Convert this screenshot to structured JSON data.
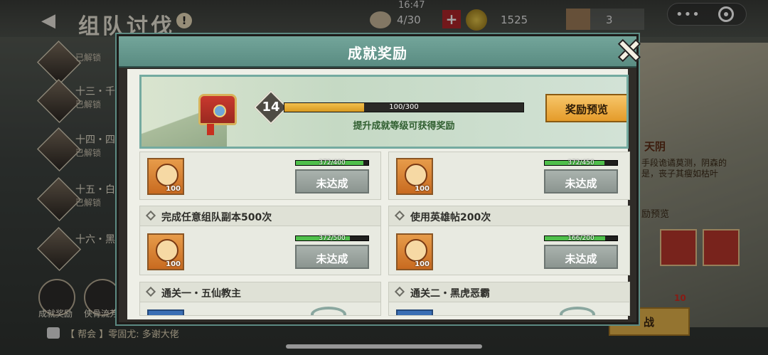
{
  "status_bar": {
    "time": "16:47"
  },
  "background": {
    "title": "组队讨伐",
    "warning_icon": "!",
    "stamina": "4/30",
    "plus_label": "+",
    "coins": "1525",
    "tickets": "3",
    "mini_menu": "•••",
    "side_items": [
      {
        "name": "",
        "status": "已解锁"
      },
      {
        "name": "十三・千面",
        "status": "已解锁"
      },
      {
        "name": "十四・四阿",
        "status": "已解锁"
      },
      {
        "name": "十五・白目",
        "status": "已解锁"
      },
      {
        "name": "十六・黑",
        "status": ""
      }
    ],
    "bottom_buttons": [
      {
        "label": "成就奖励"
      },
      {
        "label": "侠骨流芳"
      }
    ],
    "chat": "【 帮会 】零固尤: 多谢大佬",
    "right_panel": {
      "title": "天阴",
      "desc": "手段诡谲莫测，阴森的是，丧子其瘦如枯叶",
      "preview": "励预览",
      "fight_label": "战",
      "fight_cost": "10"
    }
  },
  "modal": {
    "title": "成就奖励",
    "banner": {
      "level": "14",
      "progress_text": "100/300",
      "progress": 0.333,
      "hint": "提升成就等级可获得奖励",
      "preview_button": "奖励预览"
    },
    "achievements": [
      {
        "title": "",
        "progress_text": "372/400",
        "progress": 0.93,
        "reward_qty": "100",
        "status": "未达成"
      },
      {
        "title": "",
        "progress_text": "372/450",
        "progress": 0.827,
        "reward_qty": "100",
        "status": "未达成"
      },
      {
        "title": "完成任意组队副本500次",
        "progress_text": "372/500",
        "progress": 0.744,
        "reward_qty": "100",
        "status": "未达成"
      },
      {
        "title": "使用英雄帖200次",
        "progress_text": "166/200",
        "progress": 0.83,
        "reward_qty": "100",
        "status": "未达成"
      },
      {
        "title": "通关一・五仙教主",
        "progress_text": "",
        "progress": null,
        "reward_qty": "",
        "status": ""
      },
      {
        "title": "通关二・黑虎恶霸",
        "progress_text": "",
        "progress": null,
        "reward_qty": "",
        "status": ""
      }
    ]
  },
  "colors": {
    "header_teal": "#5a8c82",
    "progress_green": "#4fbf4b",
    "xp_gold": "#e0a42a",
    "button_gold": "#f2b34d",
    "disabled_gray": "#9aa39f"
  },
  "icons": {
    "close": "close-icon",
    "chest": "treasure-chest-icon",
    "reward": "fist-badge-icon",
    "back": "back-arrow-icon",
    "more": "more-dots-icon",
    "target": "target-circle-icon"
  }
}
